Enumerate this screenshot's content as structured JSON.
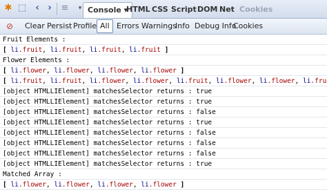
{
  "toolbar": {
    "tabs": [
      {
        "label": "Console ▾",
        "active": true
      },
      {
        "label": "HTML"
      },
      {
        "label": "CSS"
      },
      {
        "label": "Script"
      },
      {
        "label": "DOM"
      },
      {
        "label": "Net"
      },
      {
        "label": "Cookies",
        "disabled": true
      }
    ]
  },
  "filterbar": {
    "clear": "Clear",
    "persist": "Persist",
    "profile": "Profile",
    "all": "All",
    "errors": "Errors",
    "warnings": "Warnings",
    "info": "Info",
    "debug": "Debug Info",
    "cookies": "Cookies"
  },
  "console": {
    "fruit_heading": "Fruit Elements :",
    "fruit_items": [
      "li.fruit",
      "li.fruit",
      "li.fruit",
      "li.fruit"
    ],
    "flower_heading": "Flower Elements :",
    "flower_items": [
      "li.flower",
      "li.flower",
      "li.flower",
      "li.flower"
    ],
    "mixed_items": [
      "li.fruit",
      "li.fruit",
      "li.flower",
      "li.flower",
      "li.fruit",
      "li.flower",
      "li.flower",
      "li.fruit"
    ],
    "logs": [
      "[object HTMLLIElement]  matchesSelector returns : true",
      "[object HTMLLIElement]  matchesSelector returns : true",
      "[object HTMLLIElement]  matchesSelector returns : false",
      "[object HTMLLIElement]  matchesSelector returns : true",
      "[object HTMLLIElement]  matchesSelector returns : false",
      "[object HTMLLIElement]  matchesSelector returns : false",
      "[object HTMLLIElement]  matchesSelector returns : false",
      "[object HTMLLIElement]  matchesSelector returns : true"
    ],
    "matched_heading": "Matched Array :",
    "matched_items": [
      "li.flower",
      "li.flower",
      "li.flower",
      "li.flower"
    ]
  }
}
